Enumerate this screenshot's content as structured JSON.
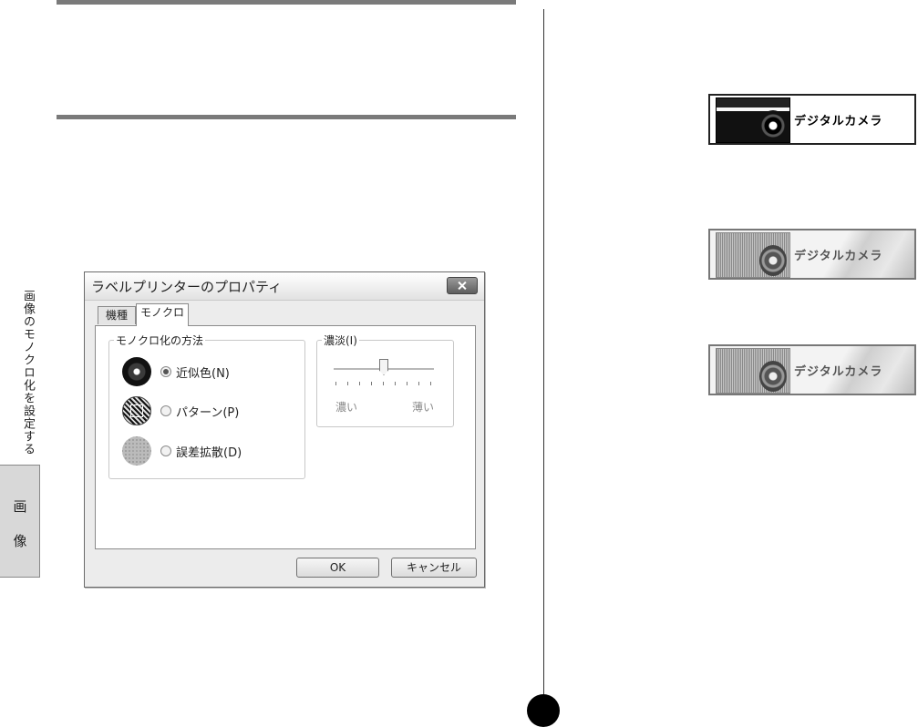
{
  "side": {
    "caption": "画像のモノクロ化を設定する",
    "tab_char_1": "画",
    "tab_char_2": "像"
  },
  "dialog": {
    "title": "ラベルプリンターのプロパティ",
    "tabs": [
      {
        "label": "機種",
        "active": false
      },
      {
        "label": "モノクロ",
        "active": true
      }
    ],
    "method_group": {
      "label": "モノクロ化の方法",
      "options": [
        {
          "label": "近似色(N)",
          "checked": true,
          "icon": "near-color-icon"
        },
        {
          "label": "パターン(P)",
          "checked": false,
          "icon": "pattern-icon"
        },
        {
          "label": "誤差拡散(D)",
          "checked": false,
          "icon": "error-diffusion-icon"
        }
      ]
    },
    "density_group": {
      "label": "濃淡(I)",
      "left_label": "濃い",
      "right_label": "薄い",
      "level": 0.5
    },
    "buttons": {
      "ok": "OK",
      "cancel": "キャンセル"
    }
  },
  "samples": [
    {
      "label": "デジタルカメラ",
      "style": "near-color"
    },
    {
      "label": "デジタルカメラ",
      "style": "pattern"
    },
    {
      "label": "デジタルカメラ",
      "style": "error-diffusion"
    }
  ]
}
